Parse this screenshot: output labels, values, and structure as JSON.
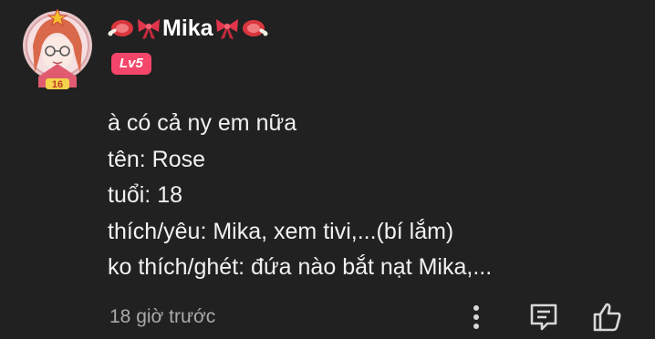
{
  "author": {
    "name": "Mika",
    "level": "Lv5"
  },
  "comment": {
    "lines": [
      "à có cả ny em nữa",
      "tên: Rose",
      "tuổi: 18",
      "thích/yêu: Mika, xem tivi,...(bí lắm)",
      "ko thích/ghét: đứa nào bắt nạt Mika,..."
    ],
    "timestamp": "18 giờ trước"
  },
  "colors": {
    "background": "#212121",
    "level_badge": "#f3466a",
    "text": "#f1f1f1",
    "muted": "#aaaaaa"
  },
  "icons": {
    "name_decorations": [
      "meat-icon",
      "ribbon-icon",
      "ribbon-icon",
      "meat-icon"
    ],
    "actions": [
      "more-vertical-icon",
      "reply-icon",
      "thumbs-up-icon"
    ]
  }
}
